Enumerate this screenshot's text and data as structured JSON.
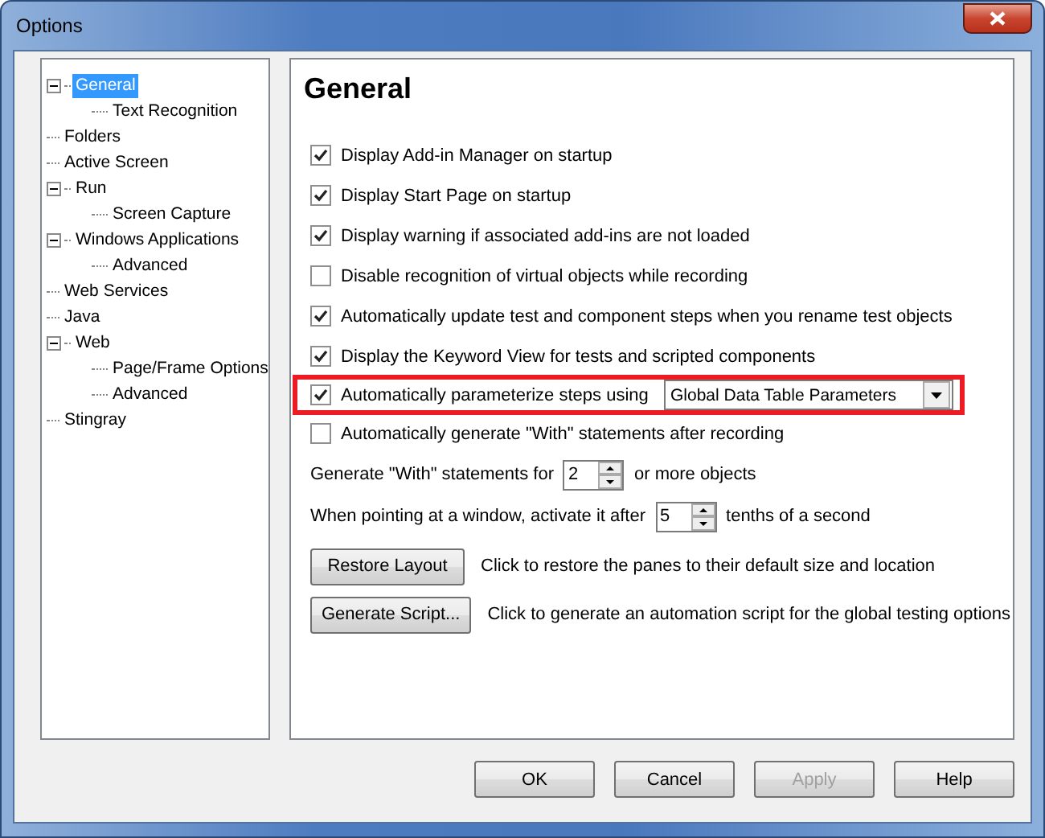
{
  "window": {
    "title": "Options"
  },
  "tree": [
    {
      "label": "General",
      "selected": true,
      "expanded": true,
      "children": [
        {
          "label": "Text Recognition",
          "selected": false
        }
      ]
    },
    {
      "label": "Folders",
      "selected": false
    },
    {
      "label": "Active Screen",
      "selected": false
    },
    {
      "label": "Run",
      "selected": false,
      "expanded": true,
      "children": [
        {
          "label": "Screen Capture",
          "selected": false
        }
      ]
    },
    {
      "label": "Windows Applications",
      "selected": false,
      "expanded": true,
      "children": [
        {
          "label": "Advanced",
          "selected": false
        }
      ]
    },
    {
      "label": "Web Services",
      "selected": false
    },
    {
      "label": "Java",
      "selected": false
    },
    {
      "label": "Web",
      "selected": false,
      "expanded": true,
      "children": [
        {
          "label": "Page/Frame Options",
          "selected": false
        },
        {
          "label": "Advanced",
          "selected": false
        }
      ]
    },
    {
      "label": "Stingray",
      "selected": false
    }
  ],
  "panel": {
    "heading": "General",
    "options": [
      {
        "label": "Display Add-in Manager on startup",
        "checked": true,
        "highlighted": false
      },
      {
        "label": "Display Start Page on startup",
        "checked": true,
        "highlighted": false
      },
      {
        "label": "Display warning if associated add-ins are not loaded",
        "checked": true,
        "highlighted": false
      },
      {
        "label": "Disable recognition of virtual objects while recording",
        "checked": false,
        "highlighted": false
      },
      {
        "label": "Automatically update test and component steps when you rename test objects",
        "checked": true,
        "highlighted": false
      },
      {
        "label": "Display the Keyword View for tests and scripted components",
        "checked": true,
        "highlighted": false
      },
      {
        "label": "Automatically parameterize steps using",
        "checked": true,
        "highlighted": true,
        "dropdown": "Global Data Table Parameters"
      },
      {
        "label": "Automatically generate \"With\" statements after recording",
        "checked": false,
        "highlighted": false
      }
    ],
    "spinners": [
      {
        "before": "Generate \"With\" statements for",
        "value": "2",
        "after": "or more objects"
      },
      {
        "before": "When pointing at a window, activate it after",
        "value": "5",
        "after": "tenths of a second"
      }
    ],
    "actions": [
      {
        "button": "Restore Layout",
        "description": "Click to restore the panes to their default size and location"
      },
      {
        "button": "Generate Script...",
        "description": "Click to generate an automation script for the global testing options"
      }
    ]
  },
  "buttons": [
    {
      "label": "OK",
      "disabled": false
    },
    {
      "label": "Cancel",
      "disabled": false
    },
    {
      "label": "Apply",
      "disabled": true
    },
    {
      "label": "Help",
      "disabled": false
    }
  ]
}
